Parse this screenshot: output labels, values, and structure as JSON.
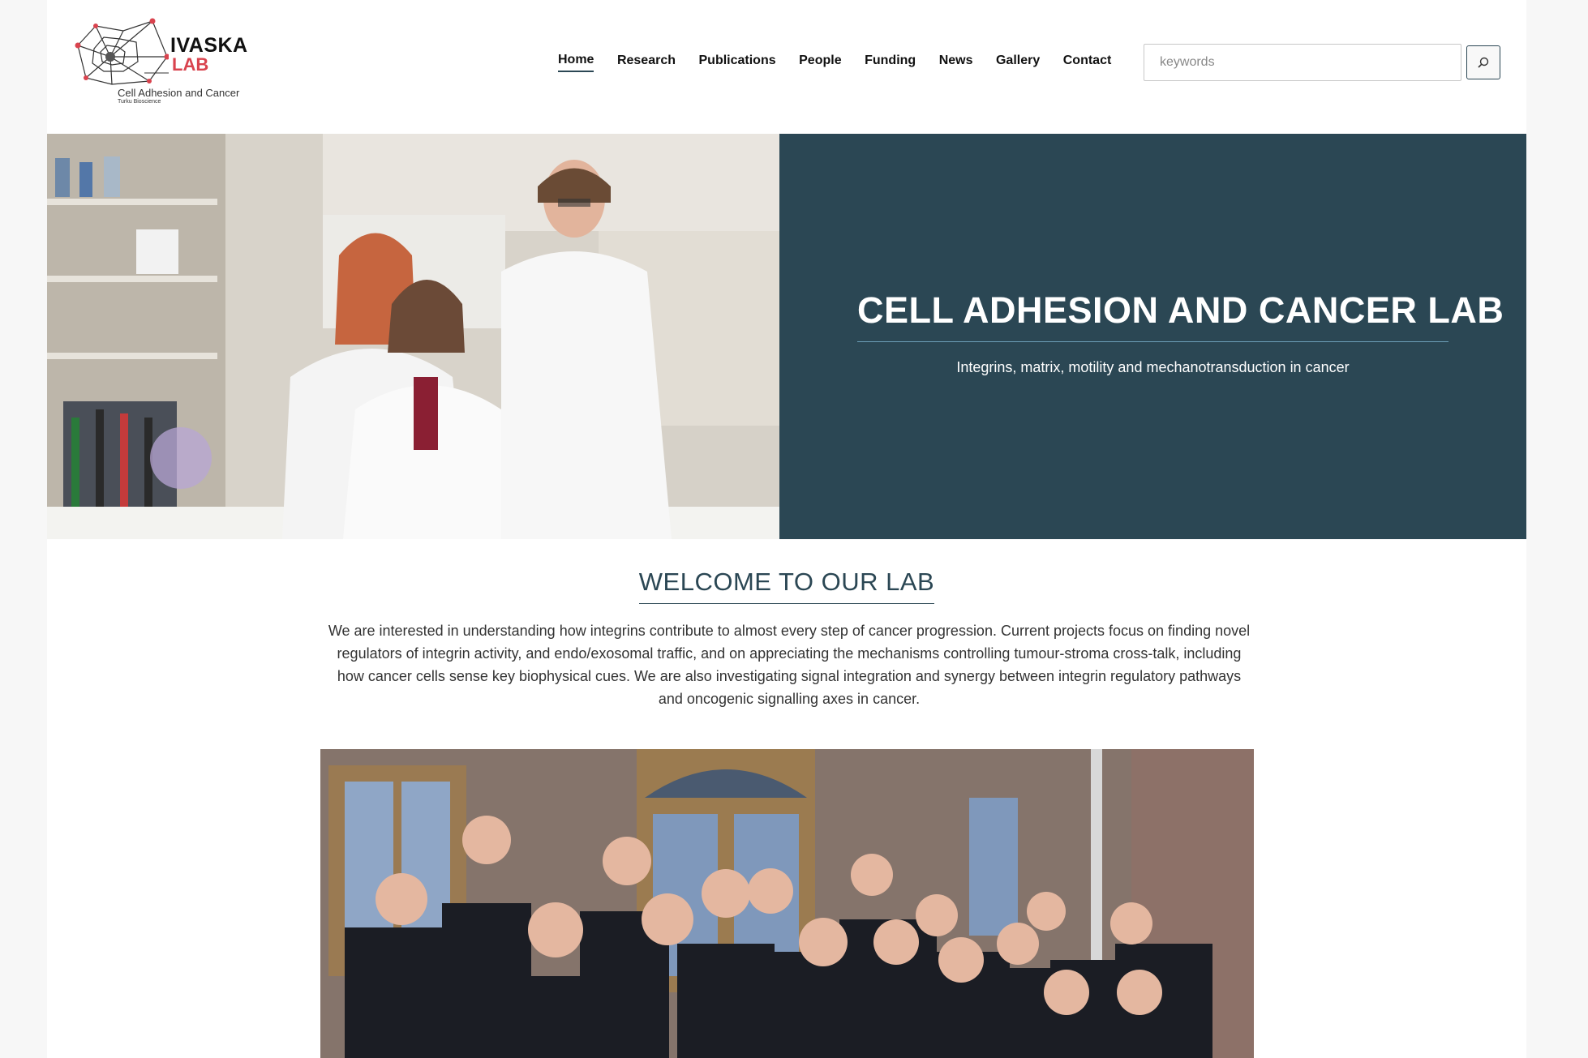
{
  "logo": {
    "brand_line1": "IVASKA",
    "brand_line2": "LAB",
    "tagline": "Cell Adhesion and Cancer",
    "subtag": "Turku Bioscience",
    "brand_color": "#d9434e"
  },
  "nav": {
    "items": [
      {
        "label": "Home",
        "active": true
      },
      {
        "label": "Research",
        "active": false
      },
      {
        "label": "Publications",
        "active": false
      },
      {
        "label": "People",
        "active": false
      },
      {
        "label": "Funding",
        "active": false
      },
      {
        "label": "News",
        "active": false
      },
      {
        "label": "Gallery",
        "active": false
      },
      {
        "label": "Contact",
        "active": false
      }
    ]
  },
  "search": {
    "placeholder": "keywords",
    "value": "",
    "button_icon": "search-icon"
  },
  "hero": {
    "title": "CELL ADHESION AND CANCER LAB",
    "subtitle": "Integrins, matrix, motility and mechanotransduction in cancer",
    "panel_color": "#2b4754"
  },
  "welcome": {
    "title": "WELCOME TO OUR LAB",
    "text": "We are interested in understanding how integrins contribute to almost every step of cancer progression. Current projects focus on finding novel regulators of integrin activity, and endo/exosomal traffic, and on appreciating the mechanisms controlling tumour-stroma cross-talk, including how cancer cells sense key biophysical cues. We are also investigating signal integration and synergy between integrin regulatory pathways and oncogenic signalling axes in cancer."
  }
}
